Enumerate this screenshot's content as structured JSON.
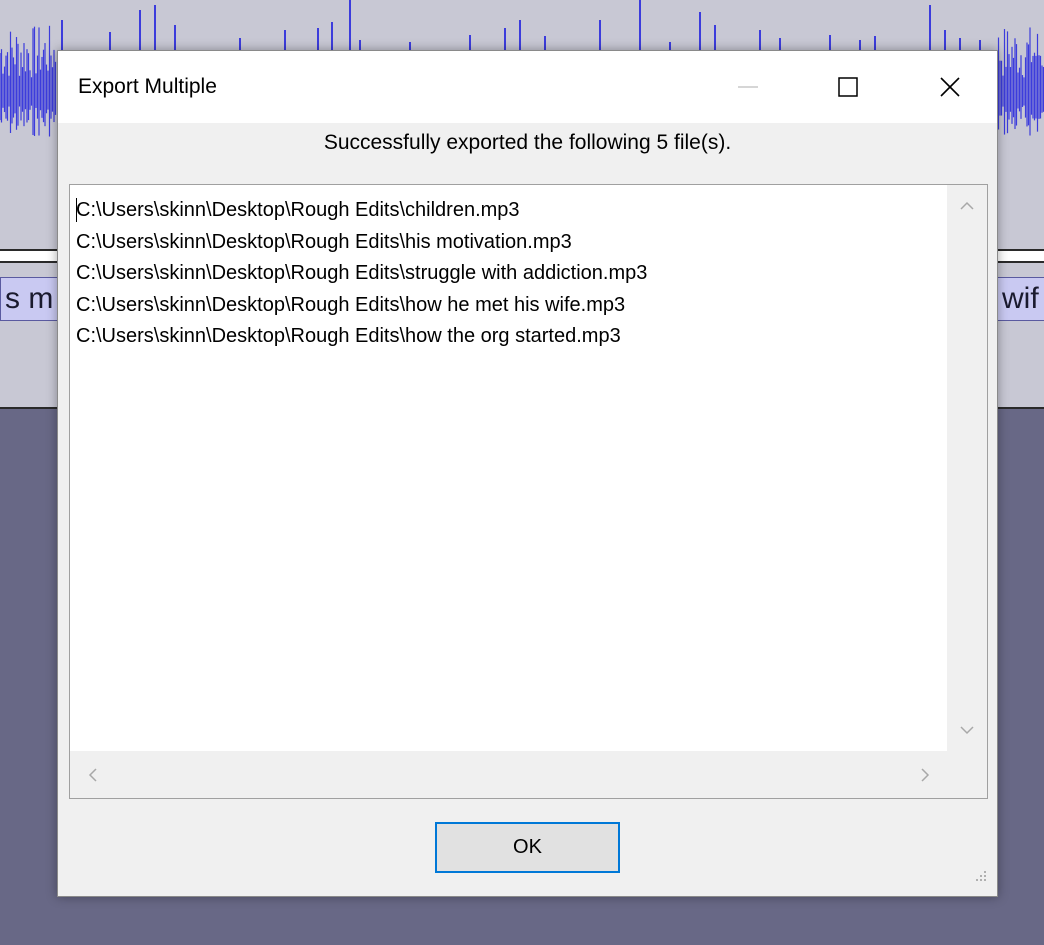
{
  "background": {
    "clip_left_label": "s m",
    "clip_right_label": "wif",
    "track_color": "#c8c8d4",
    "waveform_color": "#3c3cdc",
    "timeline_bg": "#686886"
  },
  "dialog": {
    "title": "Export Multiple",
    "message": "Successfully exported the following 5 file(s).",
    "files": [
      "C:\\Users\\skinn\\Desktop\\Rough Edits\\children.mp3",
      "C:\\Users\\skinn\\Desktop\\Rough Edits\\his motivation.mp3",
      "C:\\Users\\skinn\\Desktop\\Rough Edits\\struggle with addiction.mp3",
      "C:\\Users\\skinn\\Desktop\\Rough Edits\\how he met his wife.mp3",
      "C:\\Users\\skinn\\Desktop\\Rough Edits\\how the org started.mp3"
    ],
    "ok_label": "OK",
    "accent_color": "#0078d7"
  },
  "icons": {
    "minimize": "minimize-icon",
    "maximize": "maximize-icon",
    "close": "close-icon",
    "scroll_up": "chevron-up-icon",
    "scroll_down": "chevron-down-icon",
    "scroll_left": "chevron-left-icon",
    "scroll_right": "chevron-right-icon",
    "resize_grip": "resize-grip-icon"
  }
}
